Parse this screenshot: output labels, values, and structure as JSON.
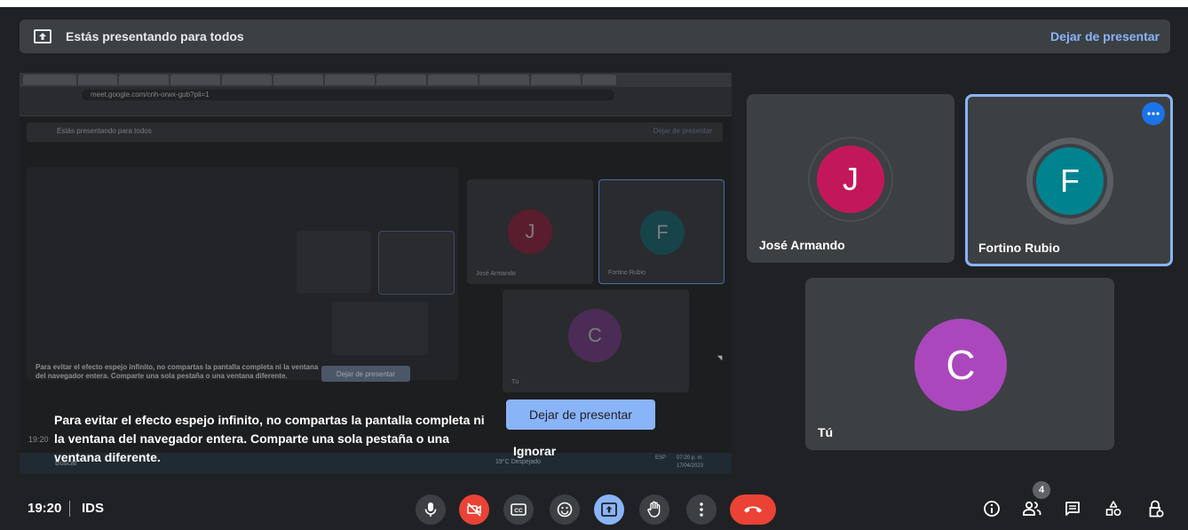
{
  "banner": {
    "text": "Estás presentando para todos",
    "stop_label": "Dejar de presentar",
    "icon": "present-to-all-icon"
  },
  "shared_screen": {
    "url": "meet.google.com/cnh-orwx-gub?pli=1",
    "warning": "Para evitar el efecto espejo infinito, no compartas la pantalla completa ni la ventana del navegador entera. Comparte una sola pestaña o una ventana diferente.",
    "stop_button_label": "Dejar de presentar",
    "ignore_label": "Ignorar",
    "mini_banner_text": "Estás presentando para todos",
    "mini_banner_stop": "Dejar de presentar",
    "mini_time": "19:20",
    "taskbar_search": "Buscar",
    "taskbar_weather": "19°C Despejado",
    "taskbar_lang": "ESP",
    "taskbar_clock": "07:20 p. m.",
    "taskbar_date": "17/04/2023",
    "ghost_participants": [
      {
        "initial": "J",
        "name": "José Armando"
      },
      {
        "initial": "F",
        "name": "Fortino Rubio"
      },
      {
        "initial": "C",
        "name": "Tú"
      }
    ]
  },
  "participants": [
    {
      "initial": "J",
      "name": "José Armando",
      "color": "#c2185b"
    },
    {
      "initial": "F",
      "name": "Fortino Rubio",
      "color": "#00838f"
    },
    {
      "initial": "C",
      "name": "Tú",
      "color": "#ab47bc"
    }
  ],
  "footer": {
    "time": "19:20",
    "meeting_code": "IDS",
    "people_count": "4"
  },
  "controls": [
    "mic-icon",
    "camera-off-icon",
    "captions-icon",
    "emoji-icon",
    "present-icon",
    "raise-hand-icon",
    "more-options-icon",
    "hang-up-icon"
  ],
  "right_controls": [
    "info-icon",
    "people-icon",
    "chat-icon",
    "activities-icon",
    "host-controls-icon"
  ]
}
